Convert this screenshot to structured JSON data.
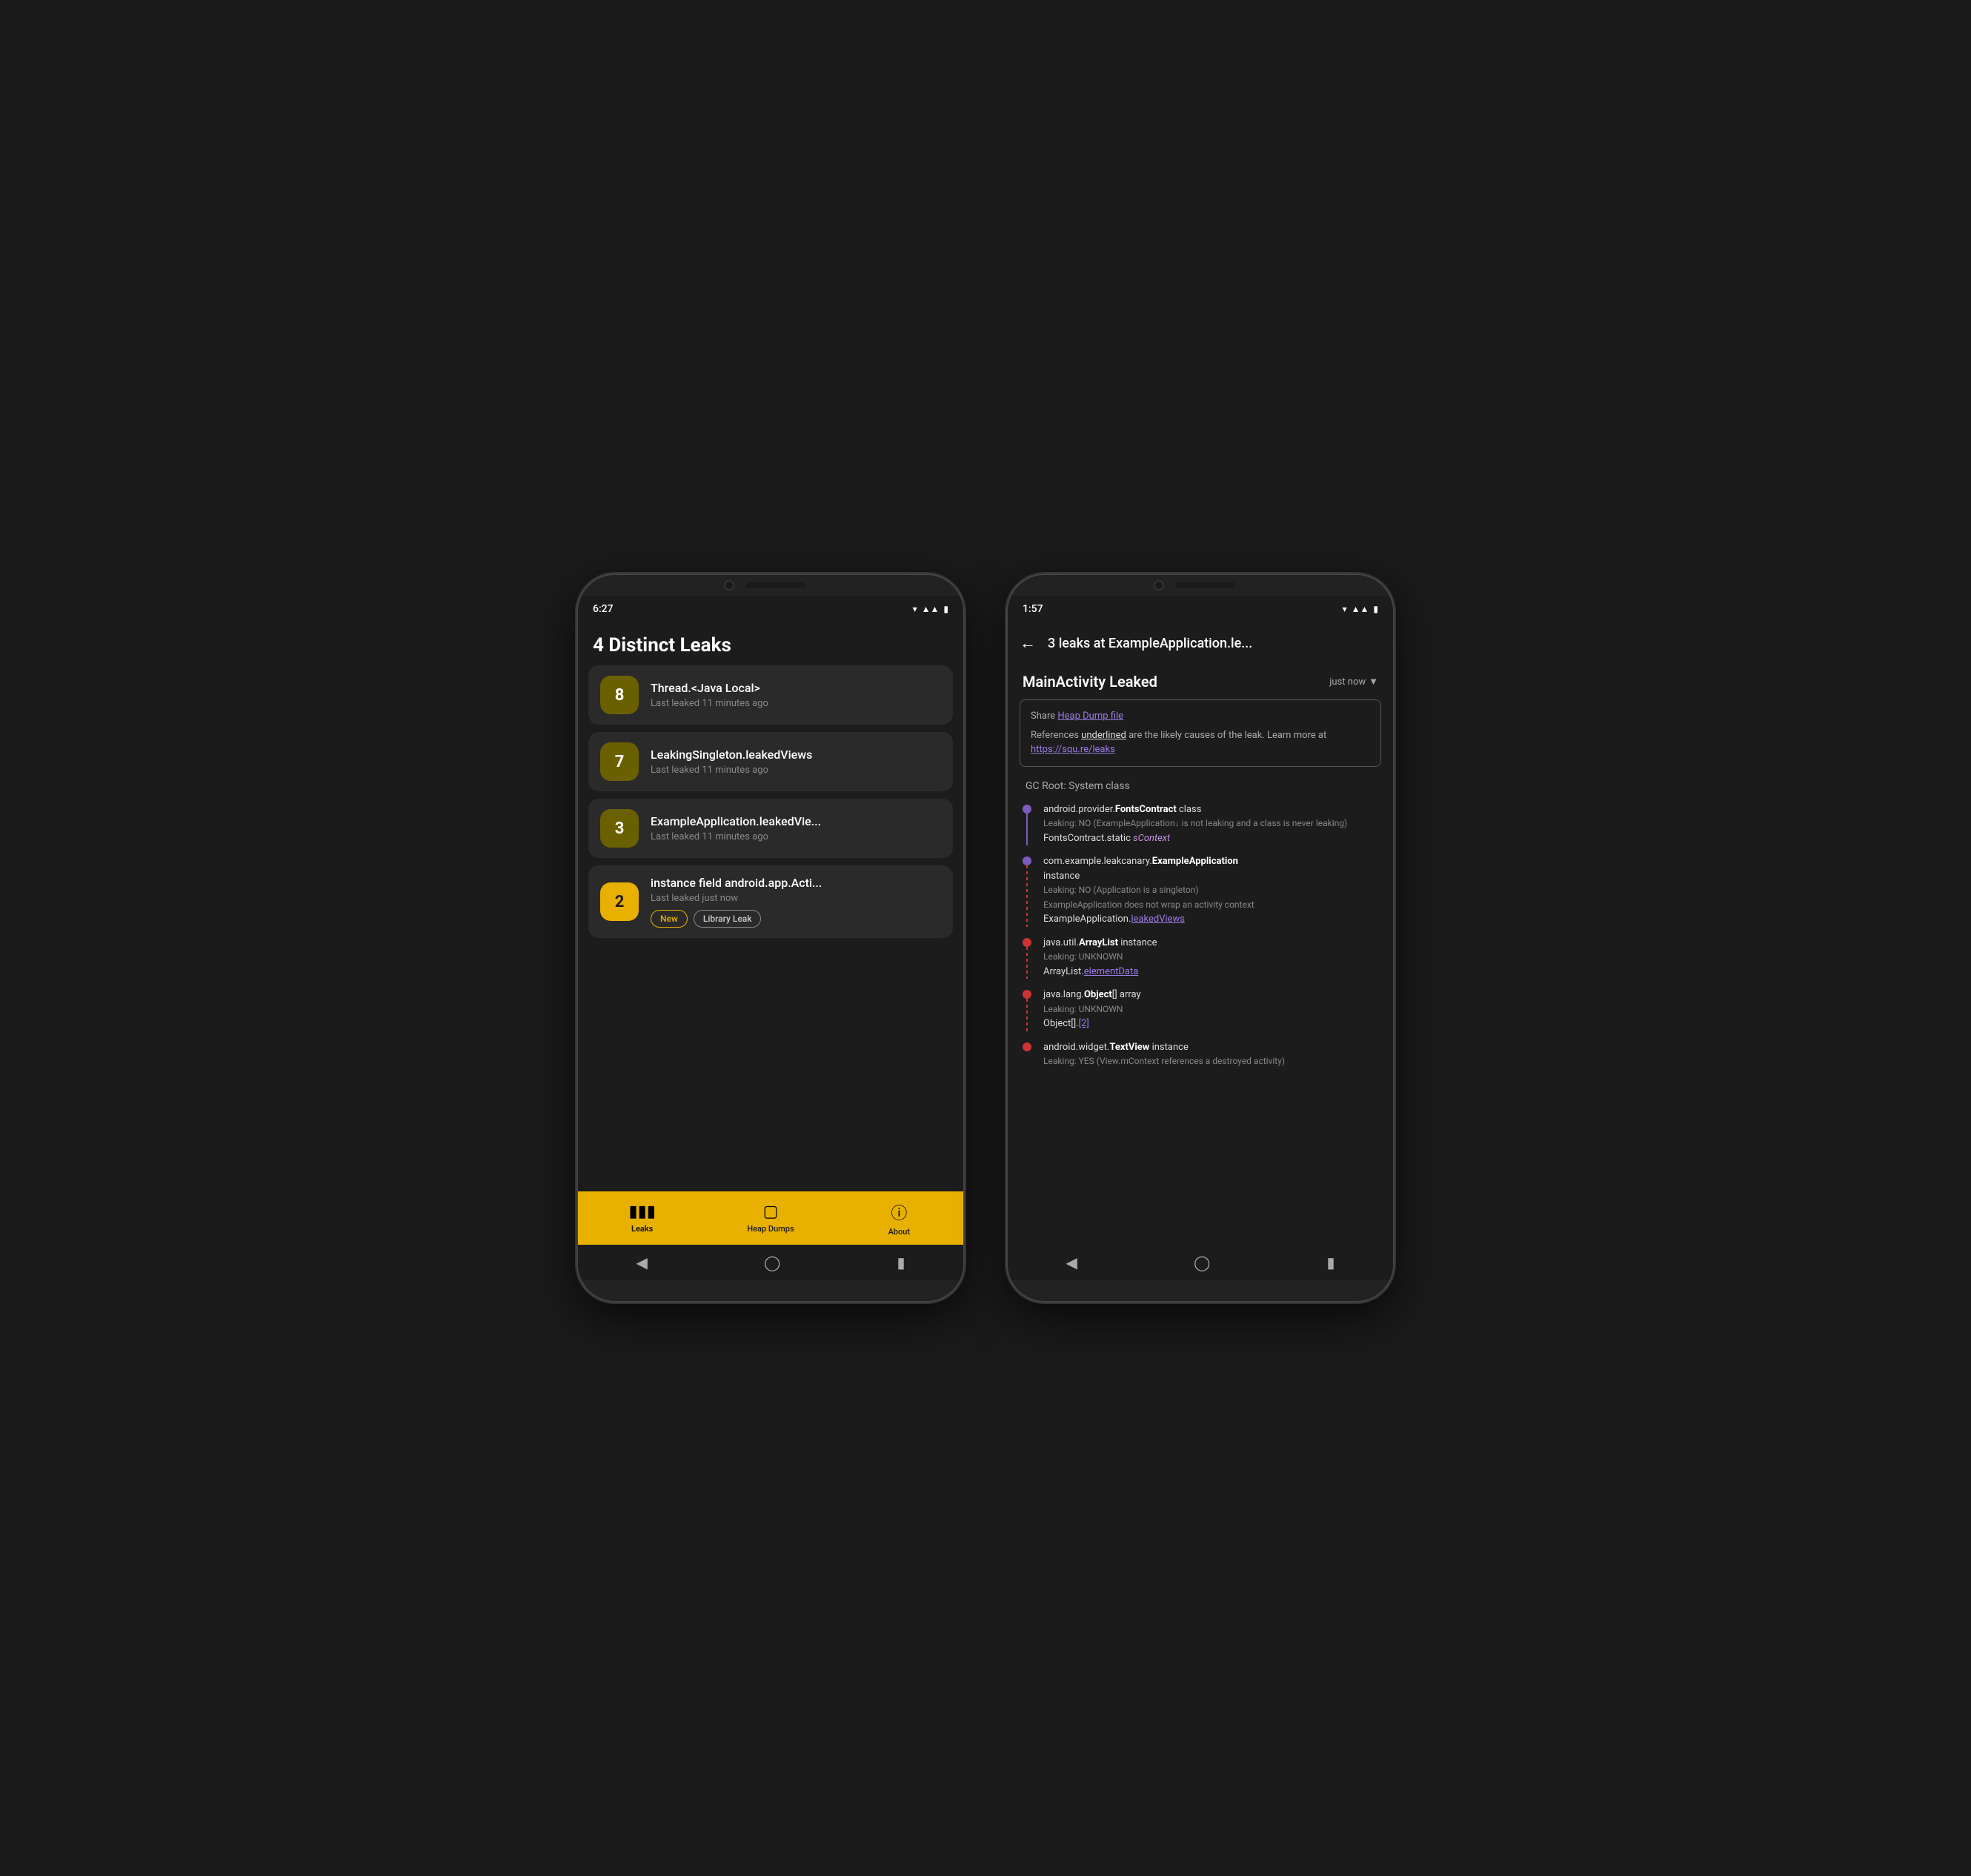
{
  "phone1": {
    "time": "6:27",
    "title": "4 Distinct Leaks",
    "leaks": [
      {
        "count": "8",
        "name": "Thread.<Java Local>",
        "time": "Last leaked 11 minutes ago",
        "badgeClass": "badge-dark",
        "tags": []
      },
      {
        "count": "7",
        "name": "LeakingSingleton.leakedViews",
        "time": "Last leaked 11 minutes ago",
        "badgeClass": "badge-dark",
        "tags": []
      },
      {
        "count": "3",
        "name": "ExampleApplication.leakedVie...",
        "time": "Last leaked 11 minutes ago",
        "badgeClass": "badge-dark",
        "tags": []
      },
      {
        "count": "2",
        "name": "instance field android.app.Acti...",
        "time": "Last leaked just now",
        "badgeClass": "badge-yellow",
        "tags": [
          "New",
          "Library Leak"
        ]
      }
    ],
    "nav": {
      "leaks": "Leaks",
      "heapDumps": "Heap Dumps",
      "about": "About"
    }
  },
  "phone2": {
    "time": "1:57",
    "appBarTitle": "3 leaks at ExampleApplication.le...",
    "detailTitle": "MainActivity Leaked",
    "detailTime": "just now",
    "infoBox": {
      "shareText": "Share ",
      "shareLinkText": "Heap Dump file",
      "line2": "References ",
      "underlinedText": "underlined",
      "line2b": " are the likely causes of the leak. Learn more at ",
      "learnMoreLink": "https://squ.re/leaks"
    },
    "gcRoot": "GC Root: System class",
    "traceItems": [
      {
        "className": "android.provider.",
        "classNameBold": "FontsContract",
        "classNameSuffix": " class",
        "leaking": "Leaking: NO (ExampleApplication↓ is not leaking and a class is never leaking)",
        "field": "FontsContract.static ",
        "fieldItalic": "sContext",
        "dotClass": "purple",
        "connectorClass": "solid"
      },
      {
        "className": "com.example.leakcanary.",
        "classNameBold": "ExampleApplication",
        "classNameSuffix": "\ninstance",
        "leaking": "Leaking: NO (Application is a singleton)\nExampleApplication does not wrap an activity context",
        "field": "ExampleApplication.",
        "fieldUnderline": "leakedViews",
        "dotClass": "purple",
        "connectorClass": "red-dash"
      },
      {
        "className": "java.util.",
        "classNameBold": "ArrayList",
        "classNameSuffix": " instance",
        "leaking": "Leaking: UNKNOWN",
        "field": "ArrayList.",
        "fieldUnderline": "elementData",
        "dotClass": "red",
        "connectorClass": "red-dash"
      },
      {
        "className": "java.lang.",
        "classNameBold": "Object",
        "classNameSuffix": "[] array",
        "leaking": "Leaking: UNKNOWN",
        "field": "Object[].",
        "fieldUnderline": "[2]",
        "dotClass": "red",
        "connectorClass": "red-dash"
      },
      {
        "className": "android.widget.",
        "classNameBold": "TextView",
        "classNameSuffix": " instance",
        "leaking": "Leaking: YES (View.mContext references a destroyed activity)",
        "field": "",
        "fieldUnderline": "",
        "dotClass": "red",
        "connectorClass": "none"
      }
    ]
  }
}
